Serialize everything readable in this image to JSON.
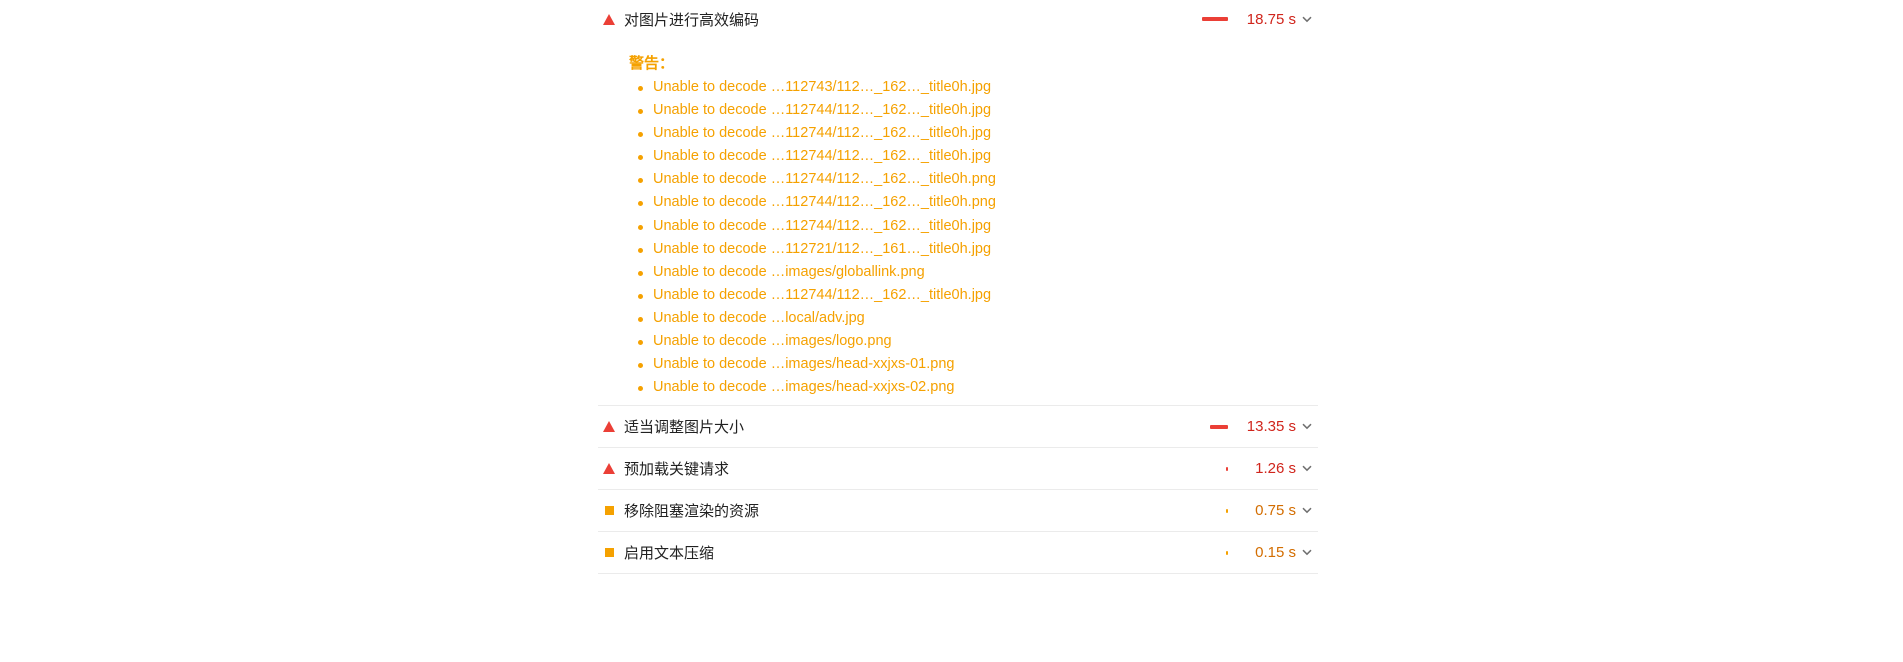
{
  "audits": [
    {
      "id": "encode-images",
      "severity": "fail",
      "title": "对图片进行高效编码",
      "savings": "18.75 s",
      "bar_fraction": 1.0,
      "expanded": true,
      "warnings_label": "警告：",
      "warnings": [
        "Unable to decode …112743/112…_162…_title0h.jpg",
        "Unable to decode …112744/112…_162…_title0h.jpg",
        "Unable to decode …112744/112…_162…_title0h.jpg",
        "Unable to decode …112744/112…_162…_title0h.jpg",
        "Unable to decode …112744/112…_162…_title0h.png",
        "Unable to decode …112744/112…_162…_title0h.png",
        "Unable to decode …112744/112…_162…_title0h.jpg",
        "Unable to decode …112721/112…_161…_title0h.jpg",
        "Unable to decode …images/globallink.png",
        "Unable to decode …112744/112…_162…_title0h.jpg",
        "Unable to decode …local/adv.jpg",
        "Unable to decode …images/logo.png",
        "Unable to decode …images/head-xxjxs-01.png",
        "Unable to decode …images/head-xxjxs-02.png"
      ]
    },
    {
      "id": "resize-images",
      "severity": "fail",
      "title": "适当调整图片大小",
      "savings": "13.35 s",
      "bar_fraction": 0.71
    },
    {
      "id": "preload-key-requests",
      "severity": "fail",
      "title": "预加载关键请求",
      "savings": "1.26 s",
      "bar_fraction": 0.07
    },
    {
      "id": "render-blocking",
      "severity": "average",
      "title": "移除阻塞渲染的资源",
      "savings": "0.75 s",
      "bar_fraction": 0.04
    },
    {
      "id": "text-compression",
      "severity": "average",
      "title": "启用文本压缩",
      "savings": "0.15 s",
      "bar_fraction": 0.01
    }
  ],
  "colors": {
    "fail": "#eb3f36",
    "average": "#f5a100",
    "fail_text": "#d0251c",
    "average_text": "#d36d00",
    "warning": "#f5a100"
  },
  "icons": {
    "fail": "red-triangle-icon",
    "average": "orange-square-icon",
    "toggle": "chevron-down-icon"
  }
}
